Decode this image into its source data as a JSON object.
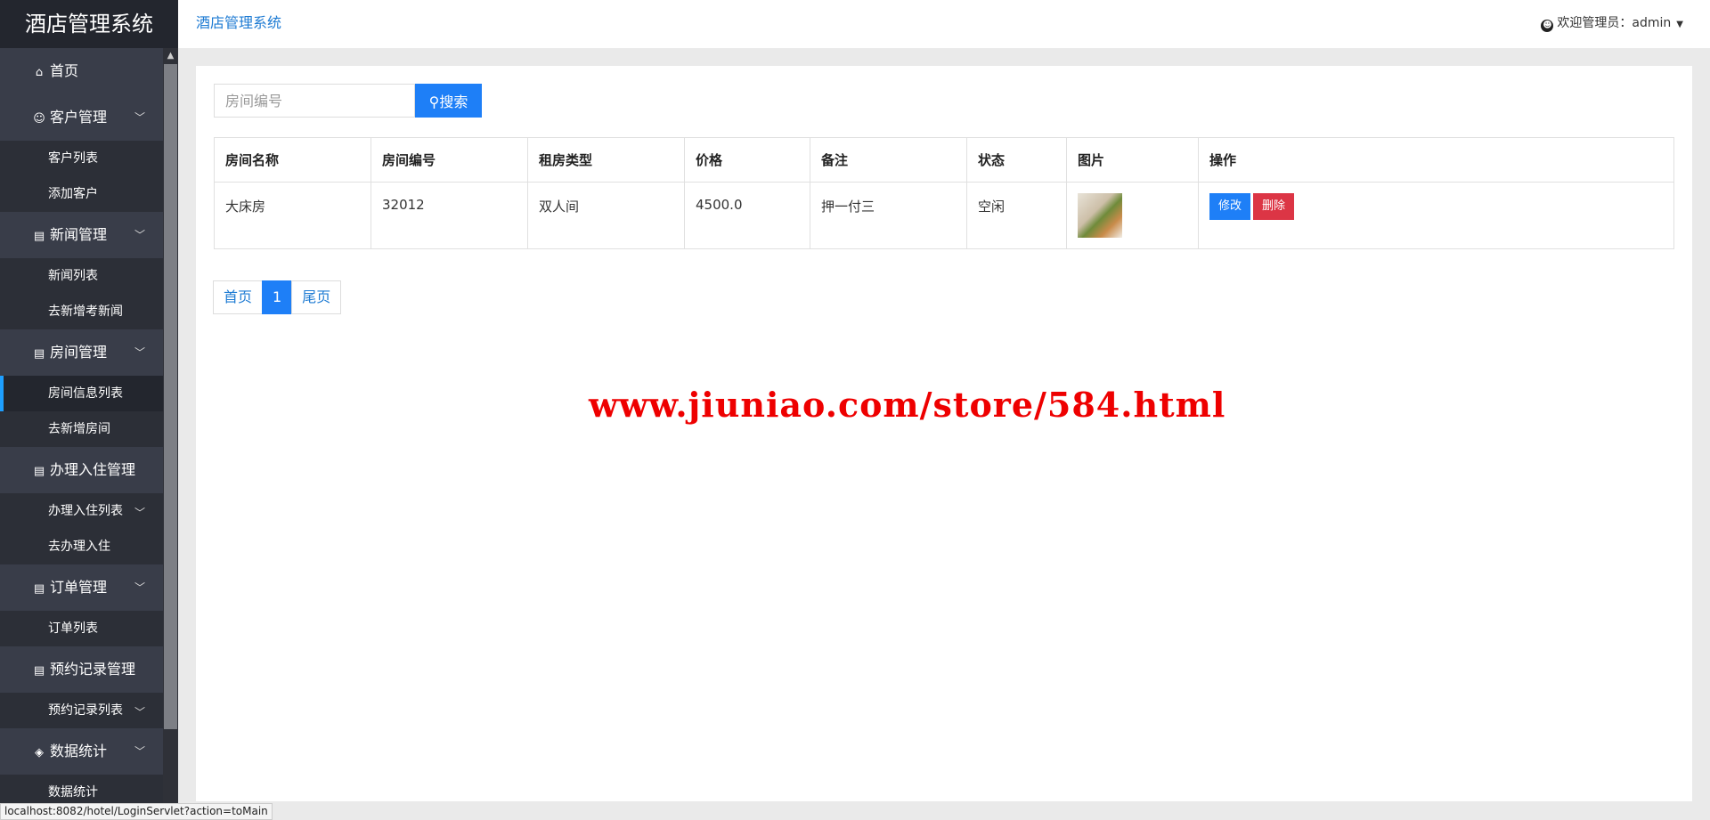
{
  "sidebar": {
    "logo": "酒店管理系统",
    "menu": [
      {
        "icon": "home-icon",
        "glyph": "⌂",
        "label": "首页",
        "expandable": false,
        "items": []
      },
      {
        "icon": "user-icon",
        "glyph": "☺",
        "label": "客户管理",
        "expandable": true,
        "items": [
          {
            "label": "客户列表"
          },
          {
            "label": "添加客户"
          }
        ]
      },
      {
        "icon": "document-icon",
        "glyph": "▤",
        "label": "新闻管理",
        "expandable": true,
        "items": [
          {
            "label": "新闻列表"
          },
          {
            "label": "去新增考新闻"
          }
        ]
      },
      {
        "icon": "document-icon",
        "glyph": "▤",
        "label": "房间管理",
        "expandable": true,
        "items": [
          {
            "label": "房间信息列表",
            "active": true
          },
          {
            "label": "去新增房间"
          }
        ]
      },
      {
        "icon": "document-icon",
        "glyph": "▤",
        "label": "办理入住管理",
        "expandable": false,
        "items": [
          {
            "label": "办理入住列表",
            "chevron": true
          },
          {
            "label": "去办理入住"
          }
        ]
      },
      {
        "icon": "document-icon",
        "glyph": "▤",
        "label": "订单管理",
        "expandable": true,
        "items": [
          {
            "label": "订单列表"
          }
        ]
      },
      {
        "icon": "document-icon",
        "glyph": "▤",
        "label": "预约记录管理",
        "expandable": false,
        "items": [
          {
            "label": "预约记录列表",
            "chevron": true
          }
        ]
      },
      {
        "icon": "layers-icon",
        "glyph": "◈",
        "label": "数据统计",
        "expandable": true,
        "items": [
          {
            "label": "数据统计"
          }
        ]
      }
    ]
  },
  "header": {
    "title": "酒店管理系统",
    "welcome": "欢迎管理员：admin"
  },
  "search": {
    "placeholder": "房间编号",
    "button_label": "搜索"
  },
  "table": {
    "columns": [
      "房间名称",
      "房间编号",
      "租房类型",
      "价格",
      "备注",
      "状态",
      "图片",
      "操作"
    ],
    "rows": [
      {
        "name": "大床房",
        "number": "32012",
        "type": "双人间",
        "price": "4500.0",
        "note": "押一付三",
        "status": "空闲"
      }
    ],
    "edit_label": "修改",
    "delete_label": "删除"
  },
  "pager": {
    "first": "首页",
    "current": "1",
    "last": "尾页"
  },
  "watermark": "www.jiuniao.com/store/584.html",
  "statusbar": "localhost:8082/hotel/LoginServlet?action=toMain",
  "colors": {
    "sidebar_bg": "#393d49",
    "accent": "#1e7ff7",
    "danger": "#dc3545",
    "watermark": "#ee0000"
  }
}
